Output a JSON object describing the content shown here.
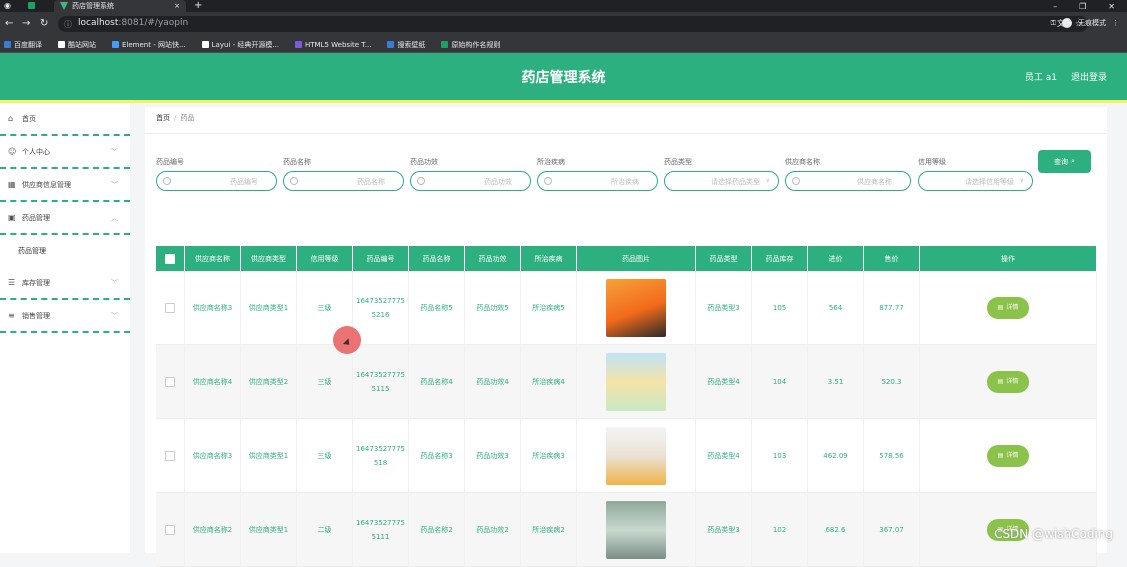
{
  "browser": {
    "tab_title": "药店管理系统",
    "url_host": "localhost",
    "url_rest": ":8081/#/yaopin",
    "incognito": "无痕模式",
    "bookmarks": [
      {
        "label": "百度翻译",
        "color": "#3a7bd5"
      },
      {
        "label": "酷站网站",
        "color": "#ffffff"
      },
      {
        "label": "Element - 网站快...",
        "color": "#409eff"
      },
      {
        "label": "Layui - 经典开源模...",
        "color": "#ffffff"
      },
      {
        "label": "HTML5 Website T...",
        "color": "#7b5cd6"
      },
      {
        "label": "搜索壁纸",
        "color": "#3a7bd5"
      },
      {
        "label": "原始构作名规则",
        "color": "#1aa260"
      }
    ]
  },
  "header": {
    "title": "药店管理系统",
    "user": "员工 a1",
    "logout": "退出登录"
  },
  "sidebar": {
    "items": [
      {
        "label": "首页",
        "icon": "home-icon",
        "has_chevron": false
      },
      {
        "label": "个人中心",
        "icon": "user-icon",
        "has_chevron": true
      },
      {
        "label": "供应商信息管理",
        "icon": "grid-icon",
        "has_chevron": true
      },
      {
        "label": "药品管理",
        "icon": "monitor-icon",
        "has_chevron": true,
        "expanded": true
      },
      {
        "label": "库存管理",
        "icon": "list-icon",
        "has_chevron": true
      },
      {
        "label": "销售管理",
        "icon": "sliders-icon",
        "has_chevron": true
      }
    ],
    "sub_item": "药品管理"
  },
  "breadcrumb": {
    "home": "首页",
    "sep": "/",
    "current": "药品"
  },
  "filters": [
    {
      "label": "药品编号",
      "placeholder": "药品编号",
      "type": "input"
    },
    {
      "label": "药品名称",
      "placeholder": "药品名称",
      "type": "input"
    },
    {
      "label": "药品功效",
      "placeholder": "药品功效",
      "type": "input"
    },
    {
      "label": "所治疾病",
      "placeholder": "所治疾病",
      "type": "input"
    },
    {
      "label": "药品类型",
      "placeholder": "请选择药品类型",
      "type": "select"
    },
    {
      "label": "供应商名称",
      "placeholder": "供应商名称",
      "type": "input"
    },
    {
      "label": "信用等级",
      "placeholder": "请选择信用等级",
      "type": "select"
    }
  ],
  "search_label": "查询",
  "table": {
    "headers": [
      "",
      "供应商名称",
      "供应商类型",
      "信用等级",
      "药品编号",
      "药品名称",
      "药品功效",
      "所治疾病",
      "药品图片",
      "药品类型",
      "药品库存",
      "进价",
      "售价",
      "操作"
    ],
    "rows": [
      [
        "",
        "供应商名称3",
        "供应商类型1",
        "三级",
        "164735277755216",
        "药品名称5",
        "药品功效5",
        "所治疾病5",
        "",
        "药品类型3",
        "105",
        "564",
        "877.77",
        "详情"
      ],
      [
        "",
        "供应商名称4",
        "供应商类型2",
        "三级",
        "164735277755115",
        "药品名称4",
        "药品功效4",
        "所治疾病4",
        "",
        "药品类型4",
        "104",
        "3.51",
        "520.3",
        "详情"
      ],
      [
        "",
        "供应商名称3",
        "供应商类型1",
        "三级",
        "16473527775518",
        "药品名称3",
        "药品功效3",
        "所治疾病3",
        "",
        "药品类型4",
        "103",
        "462.09",
        "578.56",
        "详情"
      ],
      [
        "",
        "供应商名称2",
        "供应商类型1",
        "二级",
        "164735277755111",
        "药品名称2",
        "药品功效2",
        "所治疾病2",
        "",
        "药品类型3",
        "102",
        "682.6",
        "367.07",
        "详情"
      ]
    ]
  },
  "watermark": "CSDN @wishCoding",
  "colors": {
    "primary": "#2db07f",
    "accent_strip": "#f5f25a",
    "detail_btn": "#8bc34a"
  }
}
